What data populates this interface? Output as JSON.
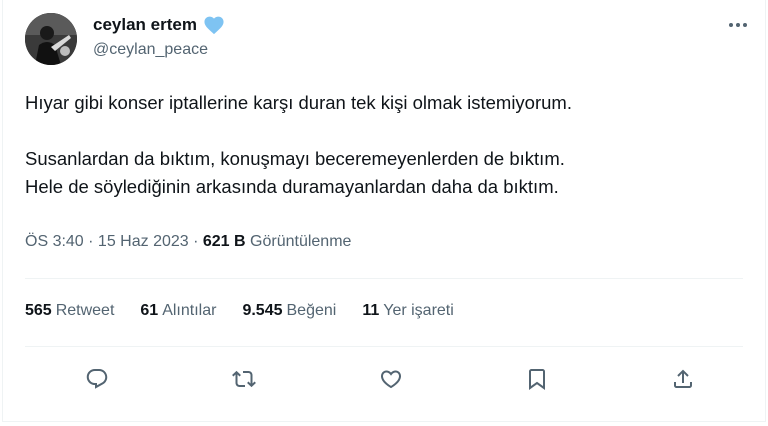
{
  "author": {
    "display_name": "ceylan ertem",
    "handle": "@ceylan_peace",
    "badge_icon": "blue-heart-icon"
  },
  "tweet": {
    "lines": [
      "Hıyar gibi konser iptallerine karşı duran tek kişi olmak istemiyorum.",
      "Susanlardan da bıktım, konuşmayı beceremeyenlerden de bıktım.",
      "Hele de söylediğinin arkasında duramayanlardan daha da bıktım."
    ]
  },
  "meta": {
    "time": "ÖS 3:40",
    "sep1": " · ",
    "date": "15 Haz 2023",
    "sep2": " · ",
    "views_count": "621 B",
    "views_label": "Görüntülenme"
  },
  "stats": [
    {
      "count": "565",
      "label": "Retweet"
    },
    {
      "count": "61",
      "label": "Alıntılar"
    },
    {
      "count": "9.545",
      "label": "Beğeni"
    },
    {
      "count": "11",
      "label": "Yer işareti"
    }
  ],
  "actions": [
    "reply-icon",
    "retweet-icon",
    "like-icon",
    "bookmark-icon",
    "share-icon"
  ],
  "colors": {
    "text": "#0f1419",
    "secondary": "#536471",
    "heart": "#7ec3f2",
    "divider": "#eff3f4"
  }
}
